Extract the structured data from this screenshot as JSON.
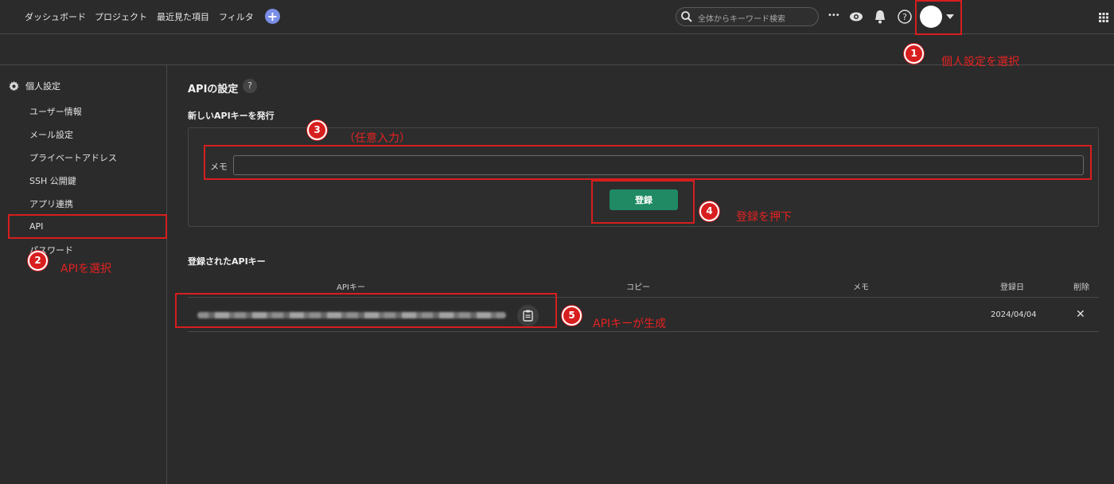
{
  "nav": {
    "links": [
      "ダッシュボード",
      "プロジェクト",
      "最近見た項目",
      "フィルタ"
    ],
    "plus_label": "+",
    "search_placeholder": "全体からキーワード検索",
    "more_label": "•••"
  },
  "sidebar": {
    "header": "個人設定",
    "items": [
      "ユーザー情報",
      "メール設定",
      "プライベートアドレス",
      "SSH 公開鍵",
      "アプリ連携",
      "API",
      "パスワード"
    ]
  },
  "main": {
    "title": "APIの設定",
    "help_label": "?",
    "new_key_title": "新しいAPIキーを発行",
    "memo_label": "メモ",
    "memo_value": "",
    "register_label": "登録",
    "registered_title": "登録されたAPIキー",
    "table": {
      "headers": [
        "APIキー",
        "コピー",
        "メモ",
        "登録日",
        "削除"
      ],
      "rows": [
        {
          "date": "2024/04/04",
          "delete": "✕"
        }
      ]
    }
  },
  "annotations": {
    "steps": [
      "1",
      "2",
      "3",
      "4",
      "5"
    ],
    "notes": [
      "個人設定を選択",
      "APIを選択",
      "（任意入力）",
      "登録を押下",
      "APIキーが生成"
    ],
    "color": "#d81e1e"
  },
  "colors": {
    "background": "#2b2b2b",
    "accent_button": "#1f8a64",
    "plus_button": "#7a8ee6"
  }
}
